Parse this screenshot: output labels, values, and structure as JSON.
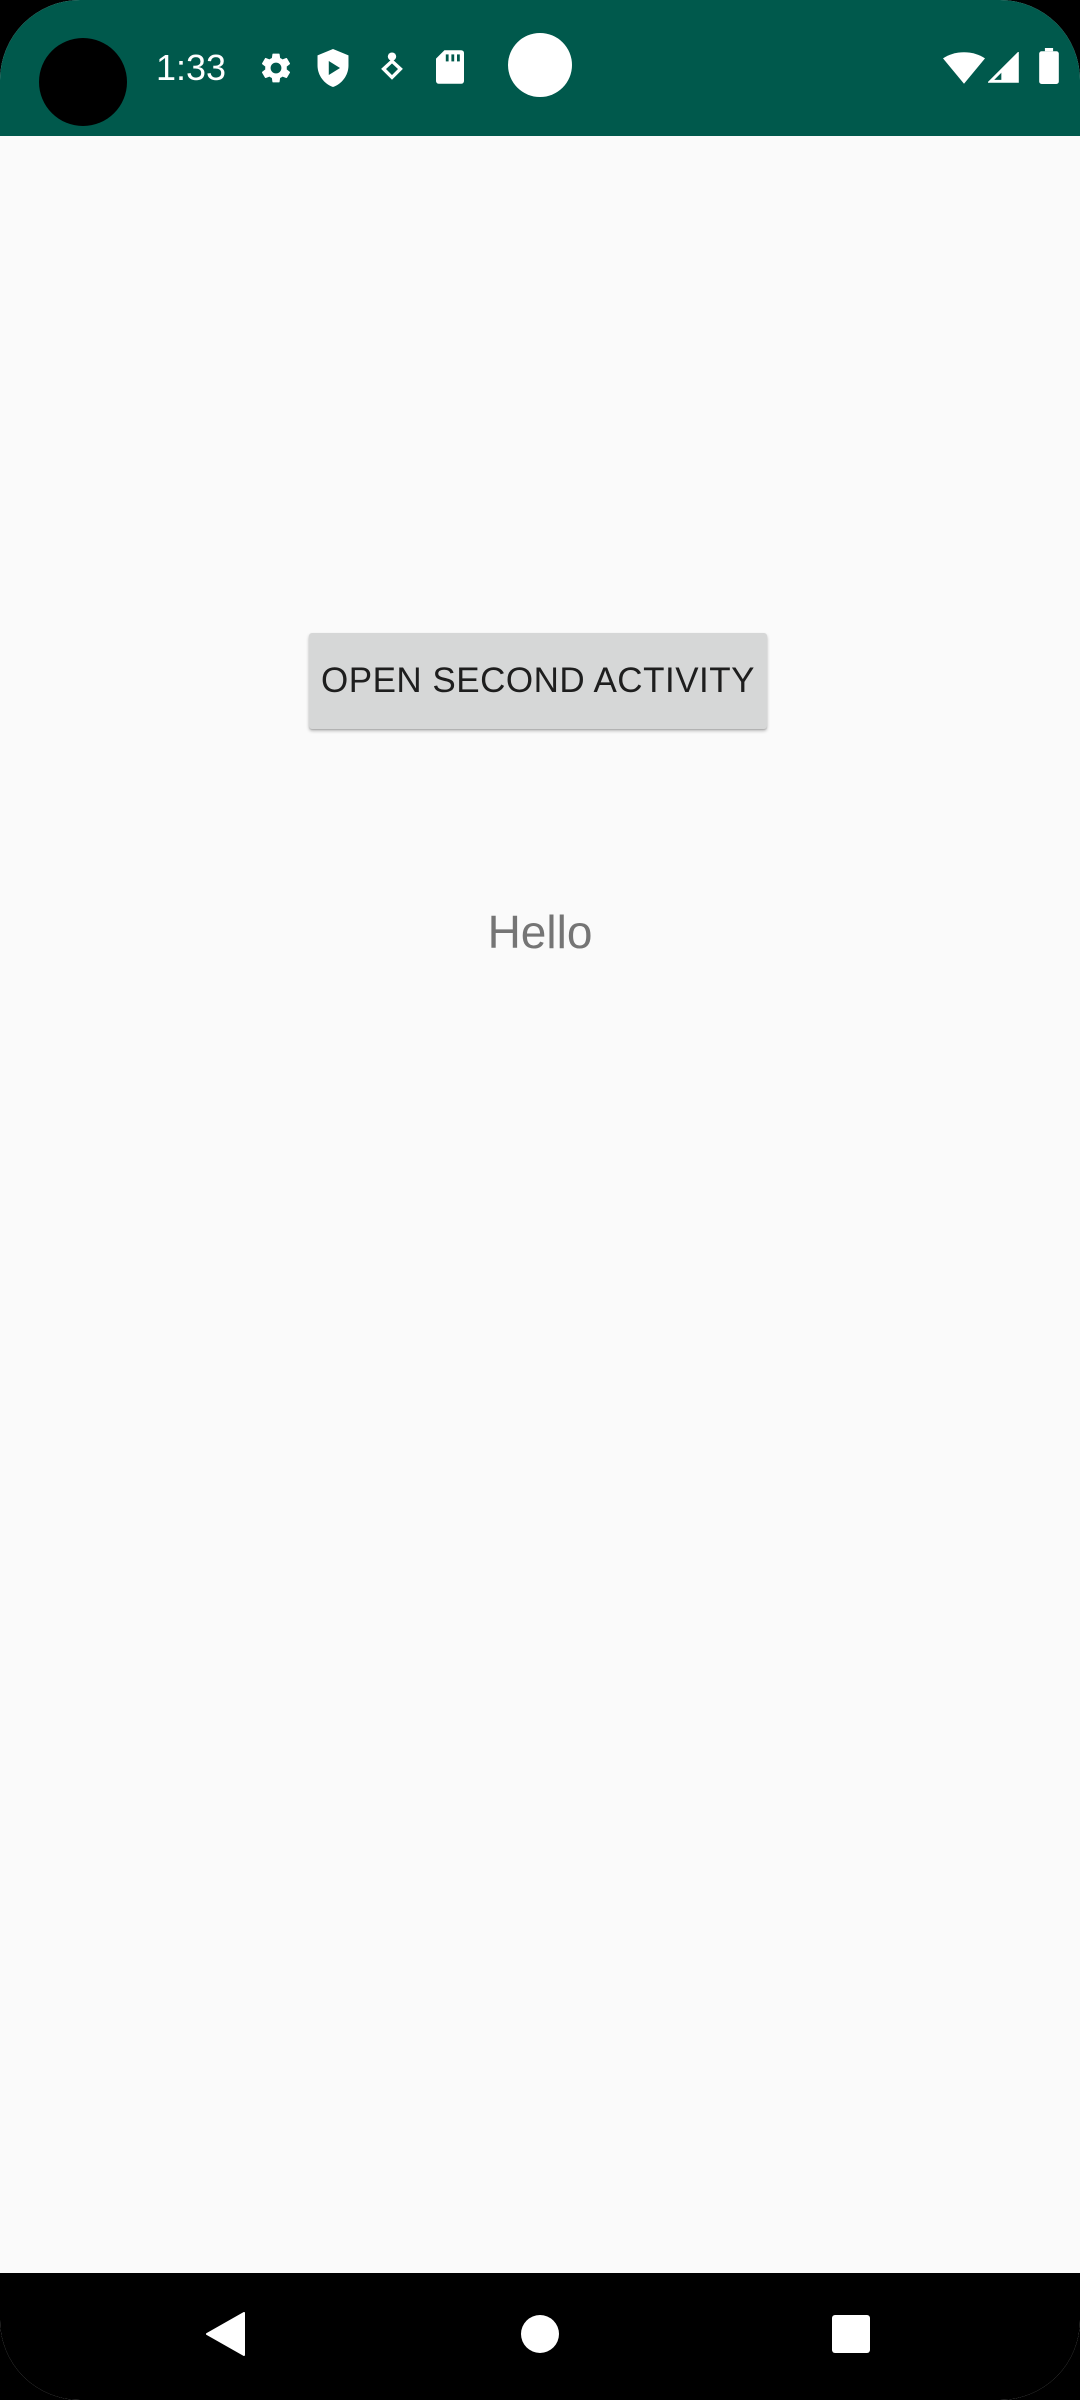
{
  "status_bar": {
    "time": "1:33",
    "background_color": "#00594c",
    "left_icons": [
      "settings-gear-icon",
      "play-protect-shield-icon",
      "location-pin-icon",
      "sd-card-icon",
      "notification-dot-icon"
    ],
    "right_icons": [
      "wifi-icon",
      "cell-signal-icon",
      "battery-icon"
    ]
  },
  "main": {
    "button_label": "OPEN SECOND ACTIVITY",
    "hello_text": "Hello"
  },
  "navigation_bar": {
    "buttons": [
      "back-icon",
      "home-icon",
      "recents-icon"
    ]
  },
  "colors": {
    "background": "#fafafa",
    "button_background": "#d6d7d7",
    "hello_text": "#757575"
  }
}
